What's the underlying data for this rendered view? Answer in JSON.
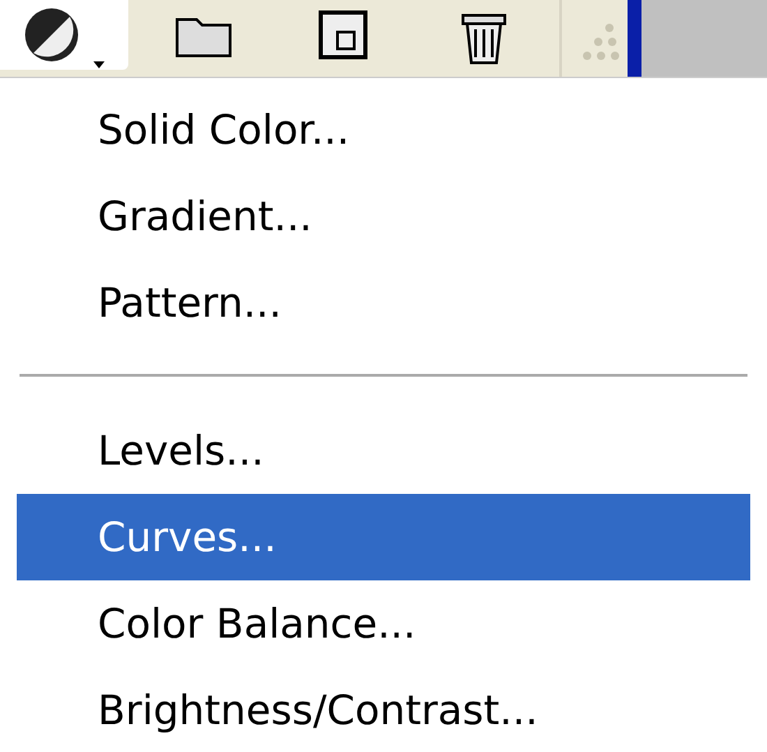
{
  "toolbar": {
    "buttons": [
      {
        "kind": "adjustment",
        "selected": true
      },
      {
        "kind": "folder",
        "selected": false
      },
      {
        "kind": "new-layer",
        "selected": false
      },
      {
        "kind": "trash",
        "selected": false
      }
    ]
  },
  "menu": {
    "items": [
      {
        "kind": "item",
        "label": "Solid Color...",
        "selected": false
      },
      {
        "kind": "item",
        "label": "Gradient...",
        "selected": false
      },
      {
        "kind": "item",
        "label": "Pattern...",
        "selected": false
      },
      {
        "kind": "separator"
      },
      {
        "kind": "item",
        "label": "Levels...",
        "selected": false
      },
      {
        "kind": "item",
        "label": "Curves...",
        "selected": true
      },
      {
        "kind": "item",
        "label": "Color Balance...",
        "selected": false
      },
      {
        "kind": "item",
        "label": "Brightness/Contrast...",
        "selected": false
      }
    ]
  }
}
